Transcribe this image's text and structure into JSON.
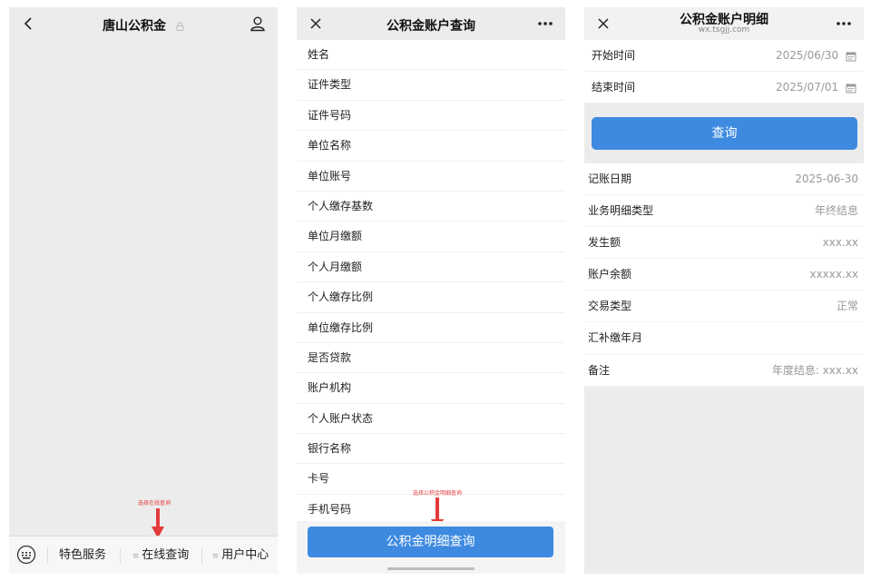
{
  "panel1": {
    "title": "唐山公积金",
    "annotation": "选择在线查询",
    "menu": [
      {
        "label": "特色服务"
      },
      {
        "label": "在线查询"
      },
      {
        "label": "用户中心"
      }
    ]
  },
  "panel2": {
    "title": "公积金账户查询",
    "fields": [
      "姓名",
      "证件类型",
      "证件号码",
      "单位名称",
      "单位账号",
      "个人缴存基数",
      "单位月缴额",
      "个人月缴额",
      "个人缴存比例",
      "单位缴存比例",
      "是否贷款",
      "账户机构",
      "个人账户状态",
      "银行名称",
      "卡号",
      "手机号码"
    ],
    "annotation": "选择公积金明细查询",
    "button_label": "公积金明细查询"
  },
  "panel3": {
    "title": "公积金账户明细",
    "subtitle": "wx.tsgjj.com",
    "start_label": "开始时间",
    "start_value": "2025/06/30",
    "end_label": "结束时间",
    "end_value": "2025/07/01",
    "query_label": "查询",
    "details": [
      {
        "label": "记账日期",
        "value": "2025-06-30"
      },
      {
        "label": "业务明细类型",
        "value": "年终结息"
      },
      {
        "label": "发生额",
        "value": "xxx.xx"
      },
      {
        "label": "账户余额",
        "value": "xxxxx.xx"
      },
      {
        "label": "交易类型",
        "value": "正常"
      },
      {
        "label": "汇补缴年月",
        "value": ""
      },
      {
        "label": "备注",
        "value": "年度结息: xxx.xx"
      }
    ]
  },
  "colors": {
    "primary_button": "#3d8ae0",
    "annotation_red": "#e23b3b",
    "background_gray": "#ececec"
  },
  "icons": [
    "back-icon",
    "lock-icon",
    "user-icon",
    "close-icon",
    "more-icon",
    "keyboard-icon",
    "calendar-icon",
    "arrow-down-icon"
  ]
}
